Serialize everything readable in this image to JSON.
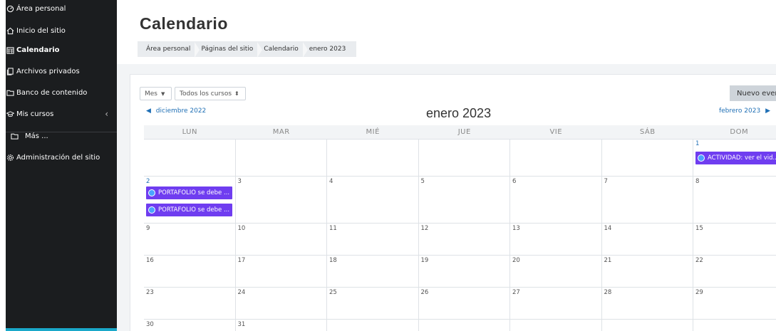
{
  "sidebar": {
    "items": [
      {
        "label": "Área personal",
        "icon": "dashboard-icon"
      },
      {
        "label": "Inicio del sitio",
        "icon": "home-icon"
      },
      {
        "label": "Calendario",
        "icon": "calendar-icon",
        "active": true
      },
      {
        "label": "Archivos privados",
        "icon": "files-icon"
      },
      {
        "label": "Banco de contenido",
        "icon": "folder-icon"
      },
      {
        "label": "Mis cursos",
        "icon": "graduation-cap-icon"
      },
      {
        "label": "Más ...",
        "icon": "folder-icon"
      },
      {
        "label": "Administración del sitio",
        "icon": "gear-icon"
      }
    ]
  },
  "page": {
    "title": "Calendario",
    "breadcrumb": [
      "Área personal",
      "Páginas del sitio",
      "Calendario",
      "enero 2023"
    ]
  },
  "controls": {
    "month_select": "Mes",
    "courses_select": "Todos los cursos",
    "new_event": "Nuevo evento"
  },
  "navigation": {
    "prev_month": "diciembre 2022",
    "current_month": "enero 2023",
    "next_month": "febrero 2023"
  },
  "calendar": {
    "weekdays": [
      "LUN",
      "MAR",
      "MIÉ",
      "JUE",
      "VIE",
      "SÁB",
      "DOM"
    ],
    "weeks": [
      [
        "",
        "",
        "",
        "",
        "",
        "",
        "1"
      ],
      [
        "2",
        "3",
        "4",
        "5",
        "6",
        "7",
        "8"
      ],
      [
        "9",
        "10",
        "11",
        "12",
        "13",
        "14",
        "15"
      ],
      [
        "16",
        "17",
        "18",
        "19",
        "20",
        "21",
        "22"
      ],
      [
        "23",
        "24",
        "25",
        "26",
        "27",
        "28",
        "29"
      ],
      [
        "30",
        "31",
        "",
        "",
        "",
        "",
        ""
      ]
    ],
    "events": {
      "day1": "ACTIVIDAD: ver el vid...",
      "day2_a": "PORTAFOLIO se debe ...",
      "day2_b": "PORTAFOLIO se debe ..."
    }
  },
  "colors": {
    "sidebar_bg": "#1b1d1f",
    "event_bg": "#6f3df0",
    "link": "#1f6fb5",
    "accent": "#1aa8c9"
  }
}
